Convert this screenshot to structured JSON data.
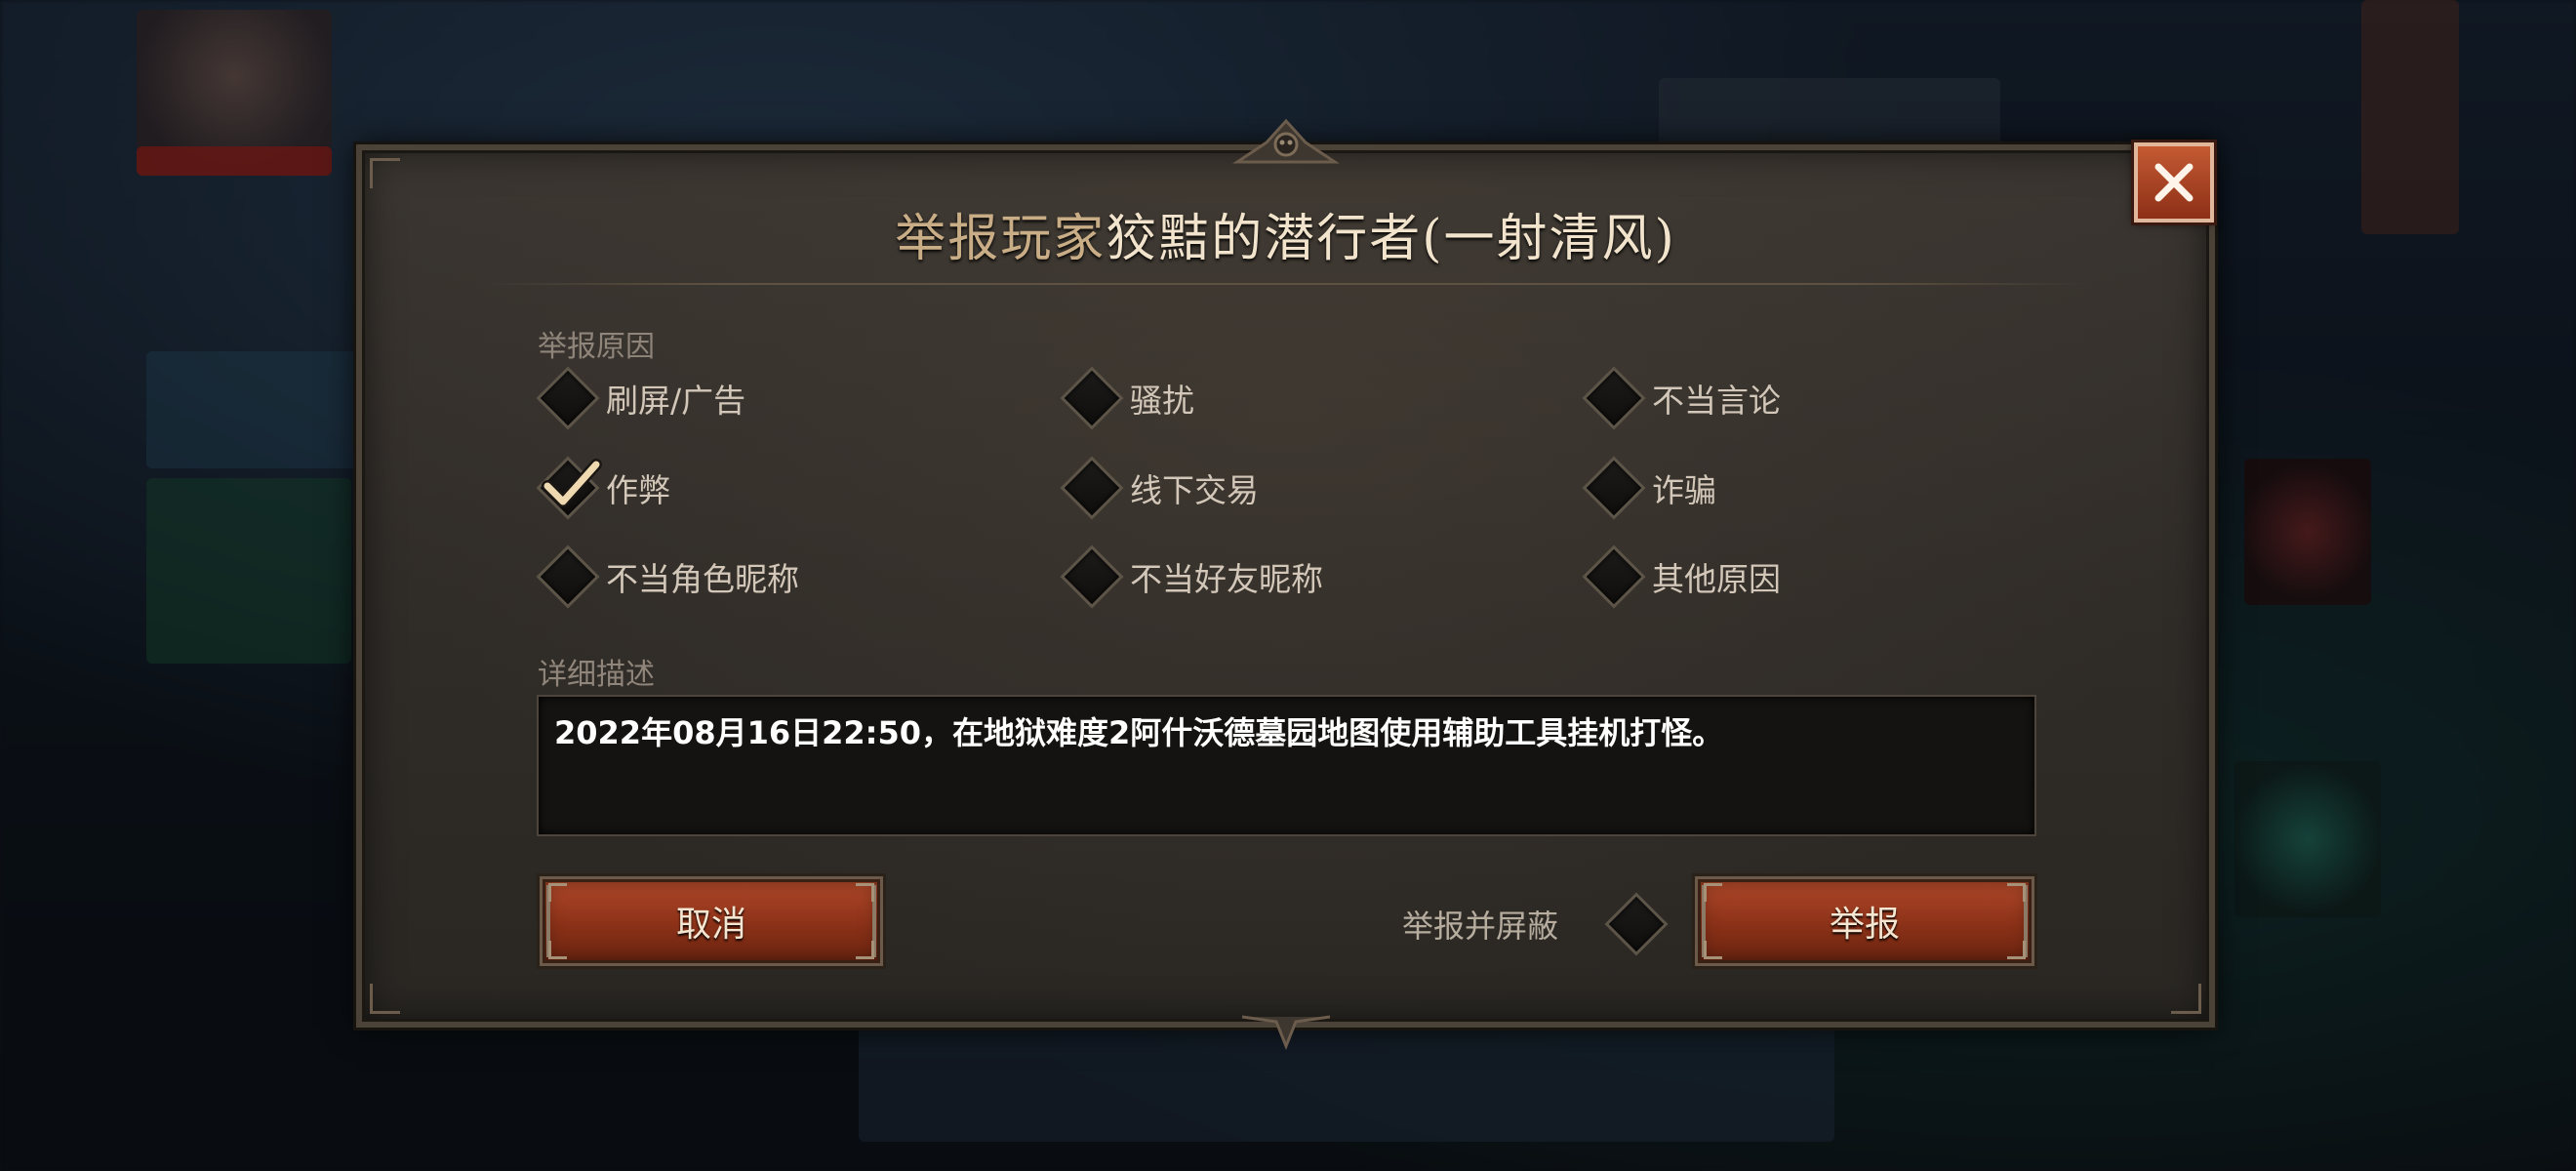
{
  "dialog": {
    "title_prefix": "举报玩家",
    "title_player": "狡黠的潜行者(一射清风)",
    "reason_label": "举报原因",
    "options": [
      {
        "label": "刷屏/广告",
        "checked": false
      },
      {
        "label": "骚扰",
        "checked": false
      },
      {
        "label": "不当言论",
        "checked": false
      },
      {
        "label": "作弊",
        "checked": true
      },
      {
        "label": "线下交易",
        "checked": false
      },
      {
        "label": "诈骗",
        "checked": false
      },
      {
        "label": "不当角色昵称",
        "checked": false
      },
      {
        "label": "不当好友昵称",
        "checked": false
      },
      {
        "label": "其他原因",
        "checked": false
      }
    ],
    "description_label": "详细描述",
    "description_value": "2022年08月16日22:50，在地狱难度2阿什沃德墓园地图使用辅助工具挂机打怪。",
    "cancel_label": "取消",
    "report_and_block_label": "举报并屏蔽",
    "report_and_block_checked": false,
    "report_label": "举报"
  },
  "colors": {
    "accent_button": "#9b3a1d",
    "title_gold": "#c9ad86",
    "panel_bg": "#332f2a"
  }
}
